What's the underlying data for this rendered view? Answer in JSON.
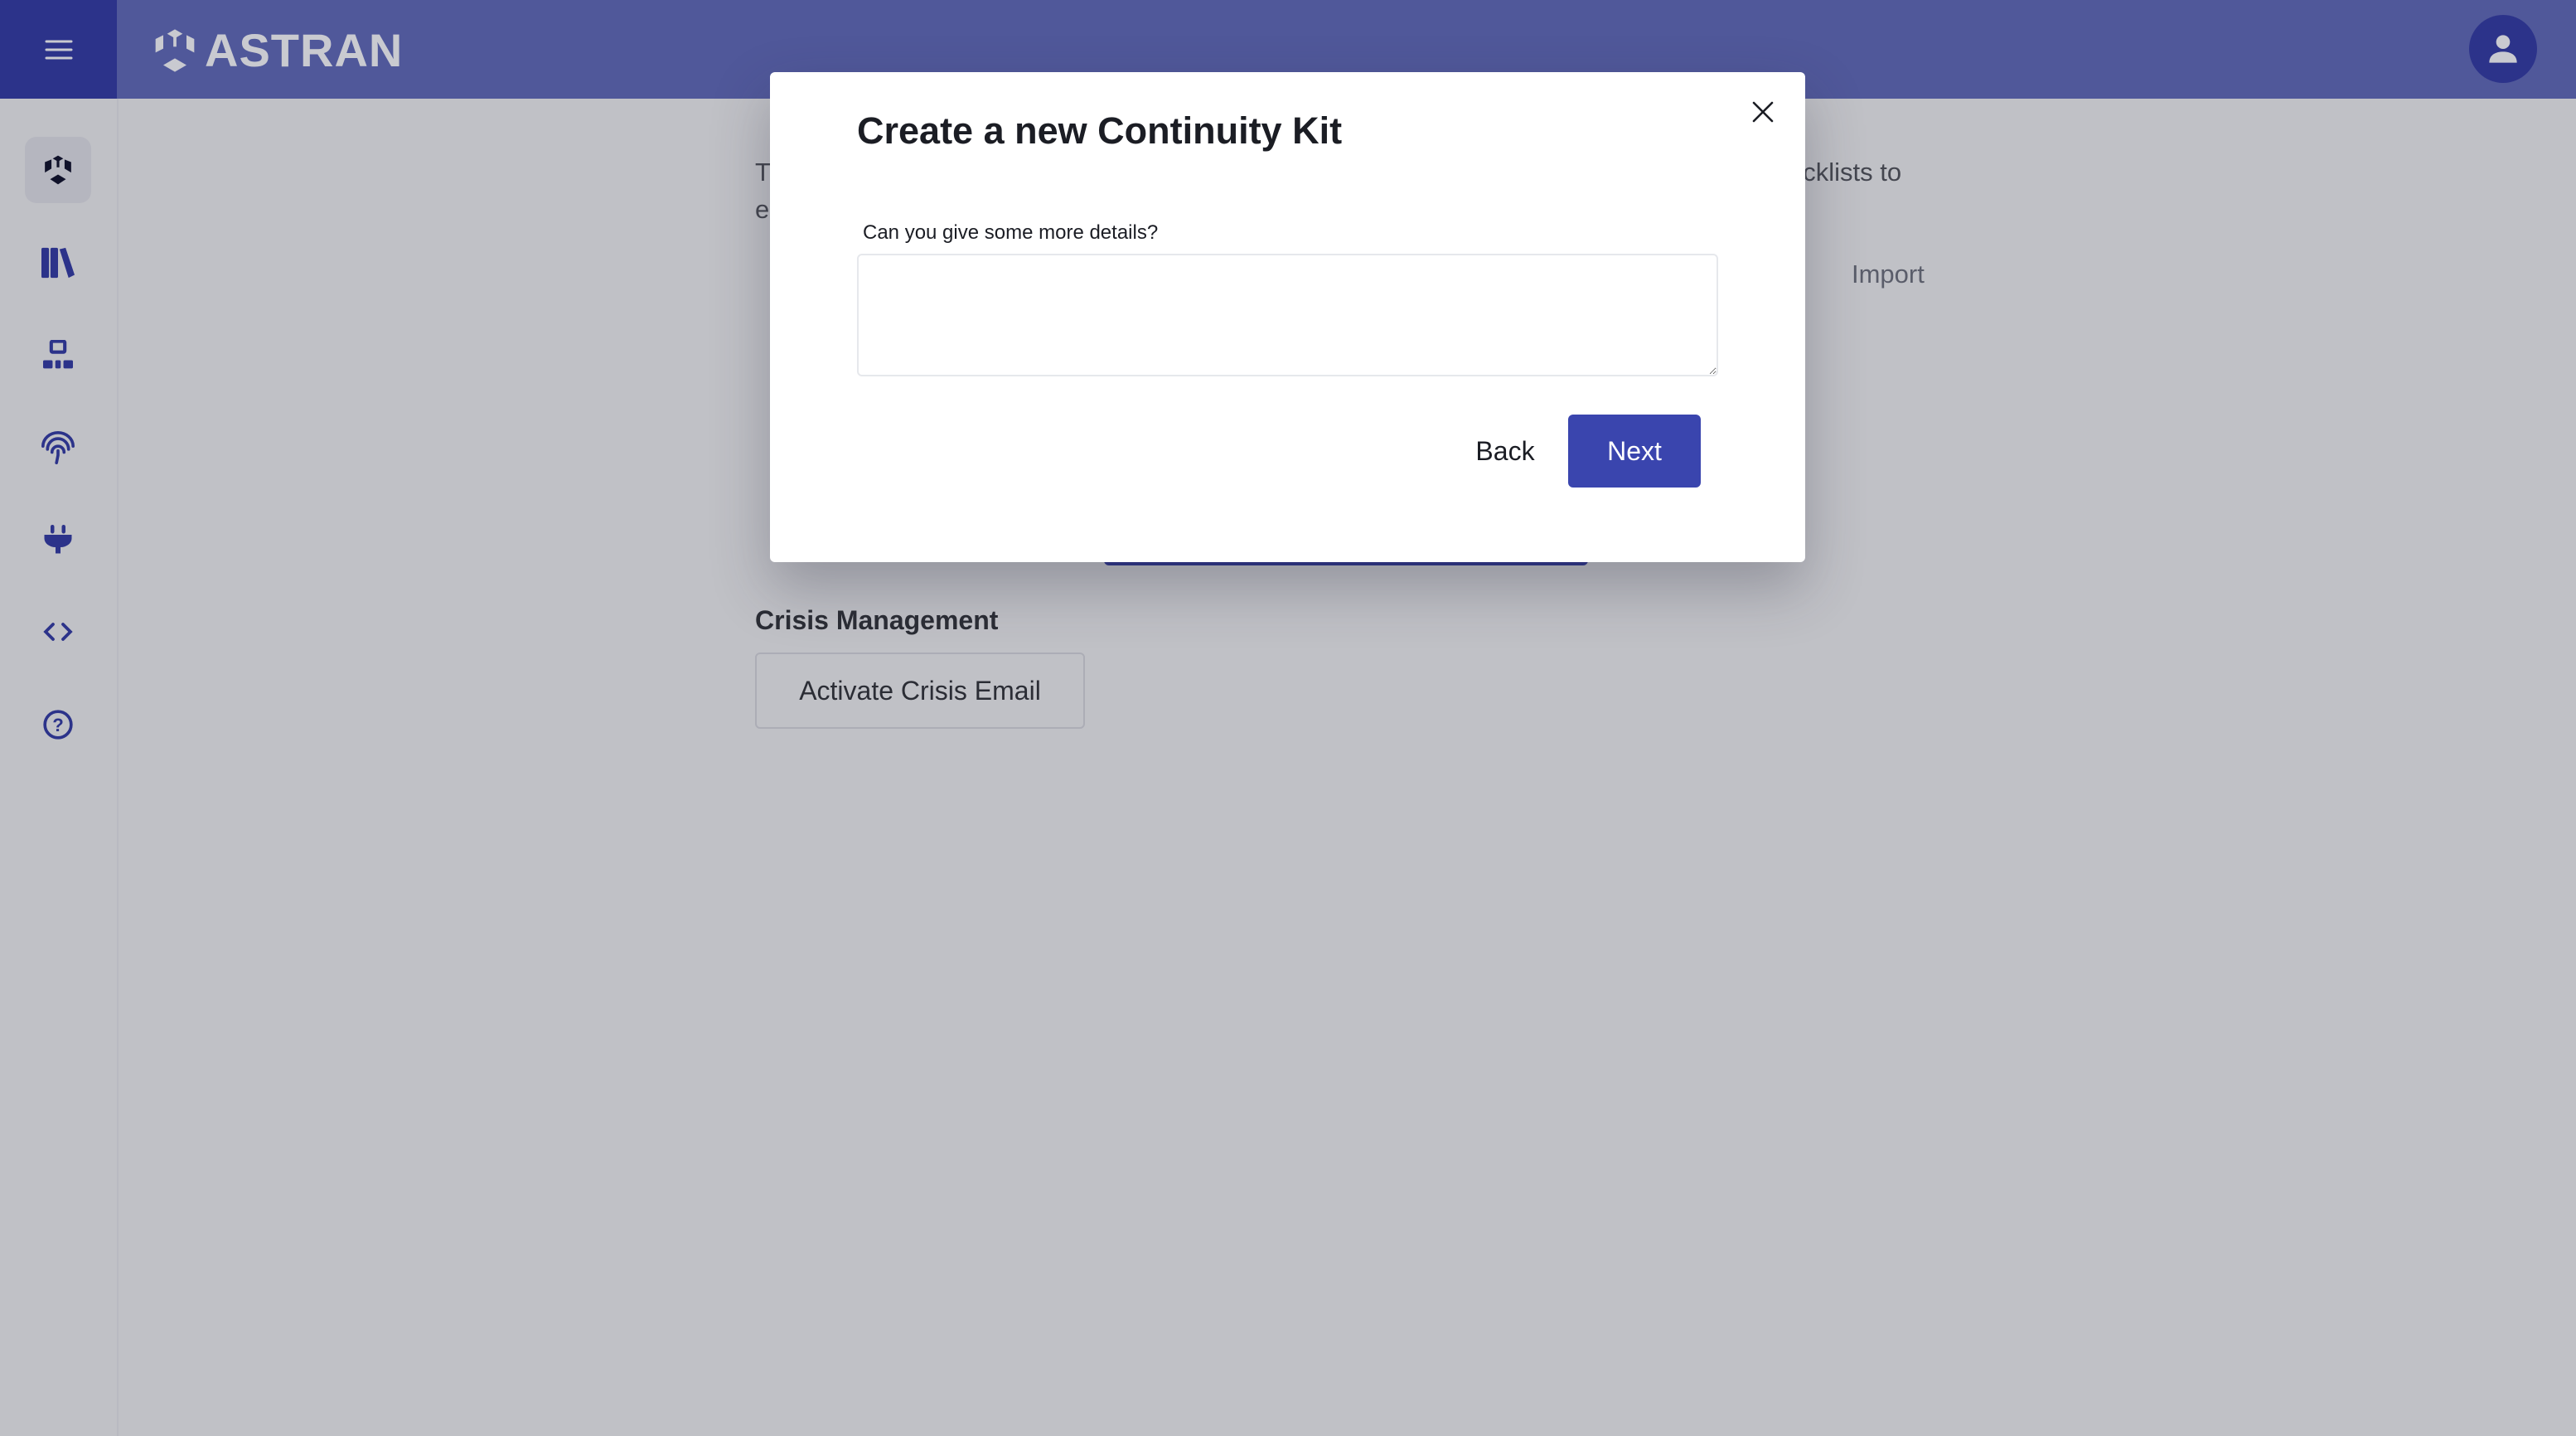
{
  "header": {
    "logo_text": "ASTRAN",
    "menu_icon": "hamburger-icon",
    "avatar_icon": "user-icon"
  },
  "sidebar": {
    "items": [
      {
        "name": "home",
        "icon": "astran-cube-icon",
        "active": true
      },
      {
        "name": "library",
        "icon": "books-icon"
      },
      {
        "name": "structure",
        "icon": "sitemap-icon"
      },
      {
        "name": "identity",
        "icon": "fingerprint-icon"
      },
      {
        "name": "integrations",
        "icon": "plug-icon"
      },
      {
        "name": "developer",
        "icon": "code-icon"
      },
      {
        "name": "help",
        "icon": "question-circle-icon"
      }
    ]
  },
  "background": {
    "text_line1_start": "T",
    "text_line2_start": "e",
    "text_line1_end": "ecklists to",
    "import_label": "Import",
    "crisis_title": "Crisis Management",
    "crisis_button": "Activate Crisis Email"
  },
  "modal": {
    "title": "Create a new Continuity Kit",
    "details_label": "Can you give some more details?",
    "details_value": "",
    "back_label": "Back",
    "next_label": "Next",
    "accent_color": "#3a45ae"
  }
}
